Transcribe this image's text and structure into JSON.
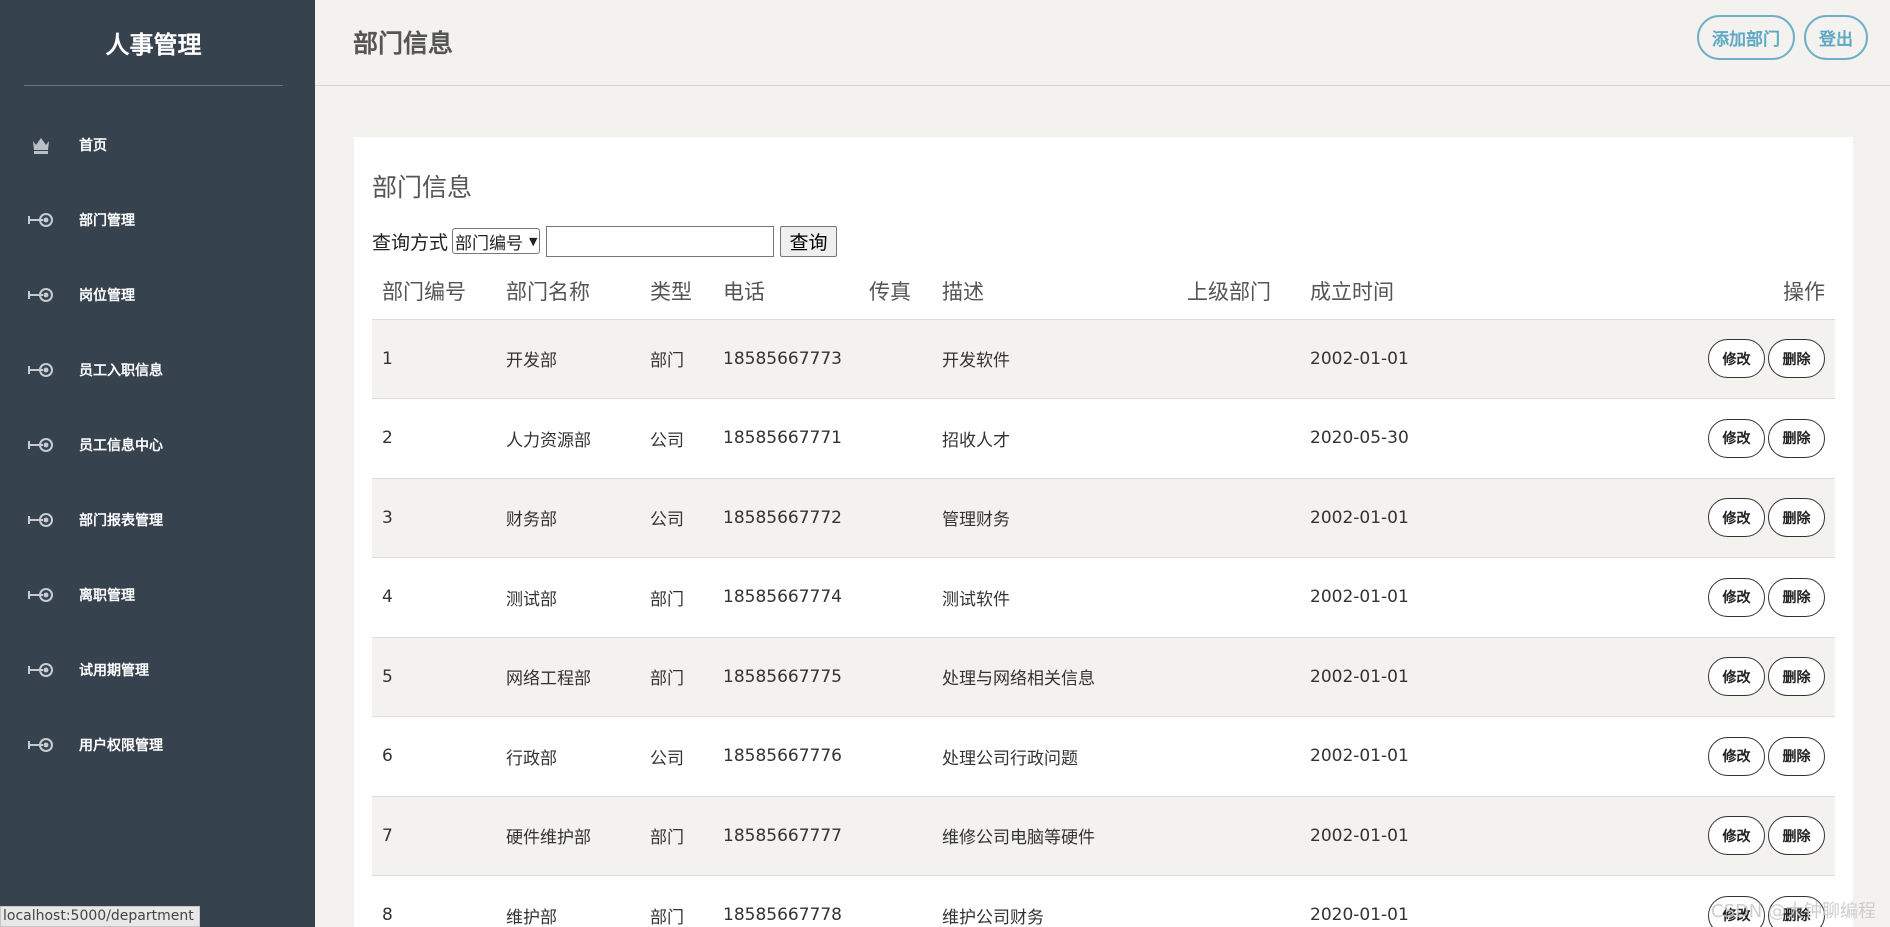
{
  "sidebar": {
    "brand": "人事管理",
    "items": [
      {
        "label": "首页",
        "icon": "home-icon"
      },
      {
        "label": "部门管理",
        "icon": "arrow-circle-icon"
      },
      {
        "label": "岗位管理",
        "icon": "arrow-circle-icon"
      },
      {
        "label": "员工入职信息",
        "icon": "arrow-circle-icon"
      },
      {
        "label": "员工信息中心",
        "icon": "arrow-circle-icon"
      },
      {
        "label": "部门报表管理",
        "icon": "arrow-circle-icon"
      },
      {
        "label": "离职管理",
        "icon": "arrow-circle-icon"
      },
      {
        "label": "试用期管理",
        "icon": "arrow-circle-icon"
      },
      {
        "label": "用户权限管理",
        "icon": "arrow-circle-icon"
      }
    ]
  },
  "header": {
    "title": "部门信息",
    "add_label": "添加部门",
    "logout_label": "登出"
  },
  "card": {
    "title": "部门信息",
    "search_label": "查询方式",
    "search_select_value": "部门编号",
    "search_input_value": "",
    "search_button": "查询"
  },
  "table": {
    "columns": [
      "部门编号",
      "部门名称",
      "类型",
      "电话",
      "传真",
      "描述",
      "上级部门",
      "成立时间",
      "操作"
    ],
    "rows": [
      {
        "id": "1",
        "name": "开发部",
        "type": "部门",
        "phone": "18585667773",
        "fax": "",
        "desc": "开发软件",
        "parent": "",
        "date": "2002-01-01"
      },
      {
        "id": "2",
        "name": "人力资源部",
        "type": "公司",
        "phone": "18585667771",
        "fax": "",
        "desc": "招收人才",
        "parent": "",
        "date": "2020-05-30"
      },
      {
        "id": "3",
        "name": "财务部",
        "type": "公司",
        "phone": "18585667772",
        "fax": "",
        "desc": "管理财务",
        "parent": "",
        "date": "2002-01-01"
      },
      {
        "id": "4",
        "name": "测试部",
        "type": "部门",
        "phone": "18585667774",
        "fax": "",
        "desc": "测试软件",
        "parent": "",
        "date": "2002-01-01"
      },
      {
        "id": "5",
        "name": "网络工程部",
        "type": "部门",
        "phone": "18585667775",
        "fax": "",
        "desc": "处理与网络相关信息",
        "parent": "",
        "date": "2002-01-01"
      },
      {
        "id": "6",
        "name": "行政部",
        "type": "公司",
        "phone": "18585667776",
        "fax": "",
        "desc": "处理公司行政问题",
        "parent": "",
        "date": "2002-01-01"
      },
      {
        "id": "7",
        "name": "硬件维护部",
        "type": "部门",
        "phone": "18585667777",
        "fax": "",
        "desc": "维修公司电脑等硬件",
        "parent": "",
        "date": "2002-01-01"
      },
      {
        "id": "8",
        "name": "维护部",
        "type": "部门",
        "phone": "18585667778",
        "fax": "",
        "desc": "维护公司财务",
        "parent": "",
        "date": "2020-01-01"
      }
    ],
    "edit_label": "修改",
    "delete_label": "删除"
  },
  "statusbar": "localhost:5000/department",
  "watermark": "CSDN @大钟聊编程",
  "colors": {
    "sidebar_bg": "#37424f",
    "accent": "#5ea8c4",
    "page_bg": "#f3f2ef"
  }
}
